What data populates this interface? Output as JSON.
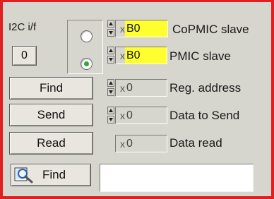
{
  "i2c": {
    "label": "I2C i/f",
    "index_value": "0"
  },
  "controls": [
    {
      "id": "copmic",
      "radix": "x",
      "value": "B0",
      "highlight": true,
      "label": "CoPMIC slave"
    },
    {
      "id": "pmic",
      "radix": "x",
      "value": "B0",
      "highlight": true,
      "label": "PMIC slave"
    },
    {
      "id": "reg",
      "radix": "x",
      "value": "0",
      "highlight": false,
      "label": "Reg. address"
    },
    {
      "id": "send",
      "radix": "x",
      "value": "0",
      "highlight": false,
      "label": "Data to Send"
    },
    {
      "id": "read",
      "radix": "x",
      "value": "0",
      "highlight": false,
      "label": "Data read"
    }
  ],
  "radio": {
    "selected": "pmic"
  },
  "buttons": {
    "find": "Find",
    "send": "Send",
    "read": "Read",
    "search_find": "Find"
  },
  "search": {
    "value": ""
  },
  "colors": {
    "frame": "#e02020",
    "panel": "#d6d6ce",
    "highlight": "#ffff30",
    "radio_dot": "#2fa83a"
  }
}
